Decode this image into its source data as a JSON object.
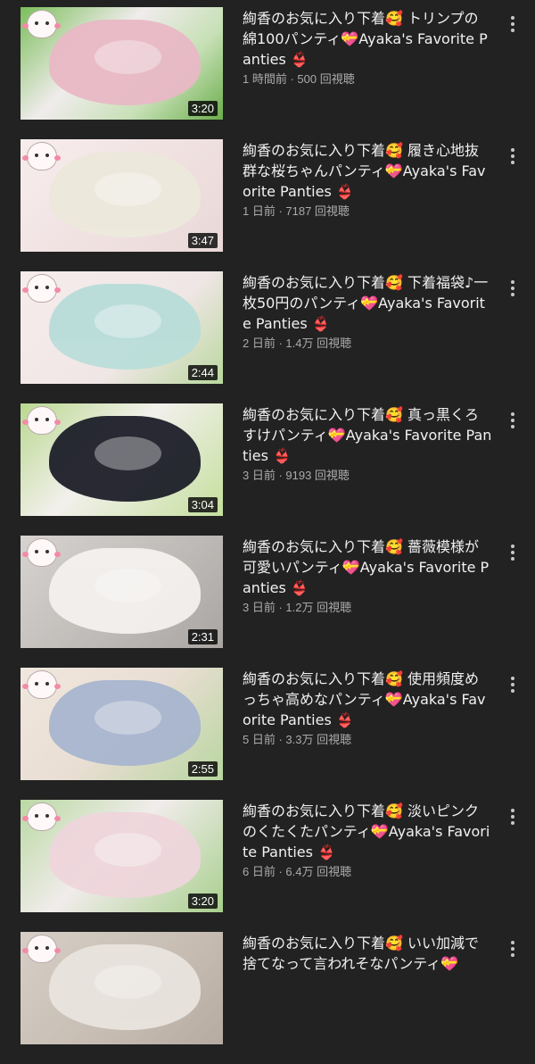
{
  "videos": [
    {
      "title": "絢香のお気に入り下着🥰 トリンプの綿100パンティ💝Ayaka's Favorite Panties 👙",
      "duration": "3:20",
      "meta": "1 時間前 · 500 回視聴",
      "thumb_bg": "#7bbf5a",
      "garment": "#e9b9c6"
    },
    {
      "title": "絢香のお気に入り下着🥰 履き心地抜群な桜ちゃんパンティ💝Ayaka's Favorite Panties 👙",
      "duration": "3:47",
      "meta": "1 日前 · 7187 回視聴",
      "thumb_bg": "#f3e4e4",
      "garment": "#ece9dc"
    },
    {
      "title": "絢香のお気に入り下着🥰 下着福袋♪一枚50円のパンティ💝Ayaka's Favorite Panties 👙",
      "duration": "2:44",
      "meta": "2 日前 · 1.4万 回視聴",
      "thumb_bg": "#f4eaea",
      "garment": "#b9ddd9"
    },
    {
      "title": "絢香のお気に入り下着🥰 真っ黒くろすけパンティ💝Ayaka's Favorite Panties 👙",
      "duration": "3:04",
      "meta": "3 日前 · 9193 回視聴",
      "thumb_bg": "#b9d88f",
      "garment": "#1e1f2a"
    },
    {
      "title": "絢香のお気に入り下着🥰 薔薇模様が可愛いパンティ💝Ayaka's Favorite Panties 👙",
      "duration": "2:31",
      "meta": "3 日前 · 1.2万 回視聴",
      "thumb_bg": "#c9c6c3",
      "garment": "#f4f1ee"
    },
    {
      "title": "絢香のお気に入り下着🥰 使用頻度めっちゃ高めなパンティ💝Ayaka's Favorite Panties 👙",
      "duration": "2:55",
      "meta": "5 日前 · 3.3万 回視聴",
      "thumb_bg": "#efe7df",
      "garment": "#a8b6cf"
    },
    {
      "title": "絢香のお気に入り下着🥰 淡いピンクのくたくたパンティ💝Ayaka's Favorite Panties 👙",
      "duration": "3:20",
      "meta": "6 日前 · 6.4万 回視聴",
      "thumb_bg": "#b9d9a2",
      "garment": "#efd6dc"
    },
    {
      "title": "絢香のお気に入り下着🥰 いい加減で捨てなって言われそなパンティ💝",
      "duration": "",
      "meta": "",
      "thumb_bg": "#cfc7bf",
      "garment": "#e9e4de"
    }
  ],
  "icons": {
    "more": "more-vert-icon"
  }
}
